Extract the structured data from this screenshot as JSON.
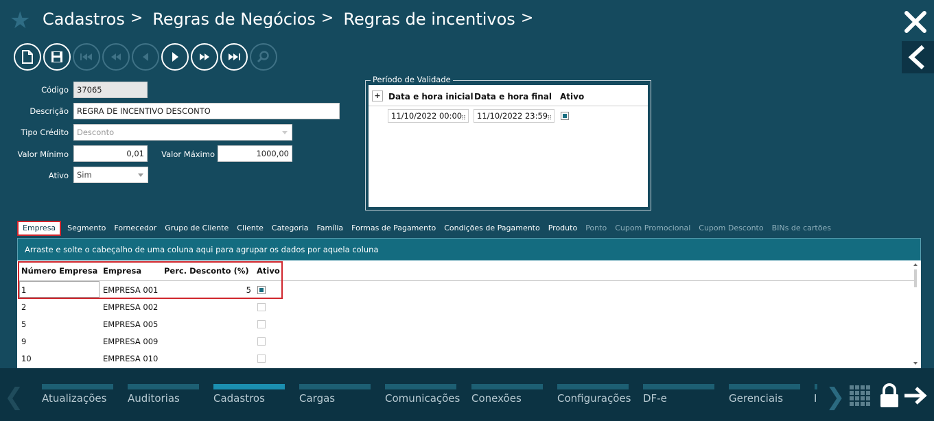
{
  "header": {
    "breadcrumb": [
      "Cadastros",
      "Regras de Negócios",
      "Regras de incentivos"
    ],
    "separator": ">"
  },
  "toolbar": {
    "buttons": [
      {
        "name": "new-document",
        "enabled": true
      },
      {
        "name": "save",
        "enabled": true
      },
      {
        "name": "first",
        "enabled": false
      },
      {
        "name": "previous-page",
        "enabled": false
      },
      {
        "name": "previous",
        "enabled": false
      },
      {
        "name": "next",
        "enabled": true
      },
      {
        "name": "next-page",
        "enabled": true
      },
      {
        "name": "last",
        "enabled": true
      },
      {
        "name": "search",
        "enabled": false
      }
    ]
  },
  "form": {
    "codigo_label": "Código",
    "codigo_value": "37065",
    "descricao_label": "Descrição",
    "descricao_value": "REGRA DE INCENTIVO DESCONTO",
    "tipo_credito_label": "Tipo Crédito",
    "tipo_credito_value": "Desconto",
    "valor_minimo_label": "Valor Mínimo",
    "valor_minimo_value": "0,01",
    "valor_maximo_label": "Valor Máximo",
    "valor_maximo_value": "1000,00",
    "ativo_label": "Ativo",
    "ativo_value": "Sim"
  },
  "validity": {
    "legend": "Período de Validade",
    "add_label": "+",
    "columns": [
      "Data e hora inicial",
      "Data e hora final",
      "Ativo"
    ],
    "rows": [
      {
        "inicio": "11/10/2022 00:00",
        "fim": "11/10/2022 23:59",
        "ativo": true
      }
    ],
    "cell_dots": "⠿"
  },
  "tabs": [
    {
      "label": "Empresa",
      "state": "active"
    },
    {
      "label": "Segmento",
      "state": "normal"
    },
    {
      "label": "Fornecedor",
      "state": "normal"
    },
    {
      "label": "Grupo de Cliente",
      "state": "normal"
    },
    {
      "label": "Cliente",
      "state": "normal"
    },
    {
      "label": "Categoria",
      "state": "normal"
    },
    {
      "label": "Família",
      "state": "normal"
    },
    {
      "label": "Formas de Pagamento",
      "state": "normal"
    },
    {
      "label": "Condições de Pagamento",
      "state": "normal"
    },
    {
      "label": "Produto",
      "state": "normal"
    },
    {
      "label": "Ponto",
      "state": "dim"
    },
    {
      "label": "Cupom Promocional",
      "state": "dim"
    },
    {
      "label": "Cupom Desconto",
      "state": "dim"
    },
    {
      "label": "BINs de cartões",
      "state": "dim"
    }
  ],
  "grid": {
    "group_hint": "Arraste e solte o cabeçalho de uma coluna aqui para agrupar os dados por aquela coluna",
    "columns": [
      "Número Empresa",
      "Empresa",
      "Perc. Desconto (%)",
      "Ativo"
    ],
    "rows": [
      {
        "numero": "1",
        "empresa": "EMPRESA 001",
        "perc": "5",
        "ativo": true
      },
      {
        "numero": "2",
        "empresa": "EMPRESA 002",
        "perc": "",
        "ativo": false
      },
      {
        "numero": "5",
        "empresa": "EMPRESA 005",
        "perc": "",
        "ativo": false
      },
      {
        "numero": "9",
        "empresa": "EMPRESA 009",
        "perc": "",
        "ativo": false
      },
      {
        "numero": "10",
        "empresa": "EMPRESA 010",
        "perc": "",
        "ativo": false
      }
    ]
  },
  "footer": {
    "nav_items": [
      {
        "label": "Atualizações",
        "active": false
      },
      {
        "label": "Auditorias",
        "active": false
      },
      {
        "label": "Cadastros",
        "active": true
      },
      {
        "label": "Cargas",
        "active": false
      },
      {
        "label": "Comunicações",
        "active": false
      },
      {
        "label": "Conexões",
        "active": false
      },
      {
        "label": "Configurações",
        "active": false
      },
      {
        "label": "DF-e",
        "active": false
      },
      {
        "label": "Gerenciais",
        "active": false
      },
      {
        "label": "I",
        "active": false
      }
    ]
  },
  "colors": {
    "background": "#154a5e",
    "footer": "#0c3343",
    "accent": "#1b8fb0",
    "highlight_red": "#d0262d"
  }
}
